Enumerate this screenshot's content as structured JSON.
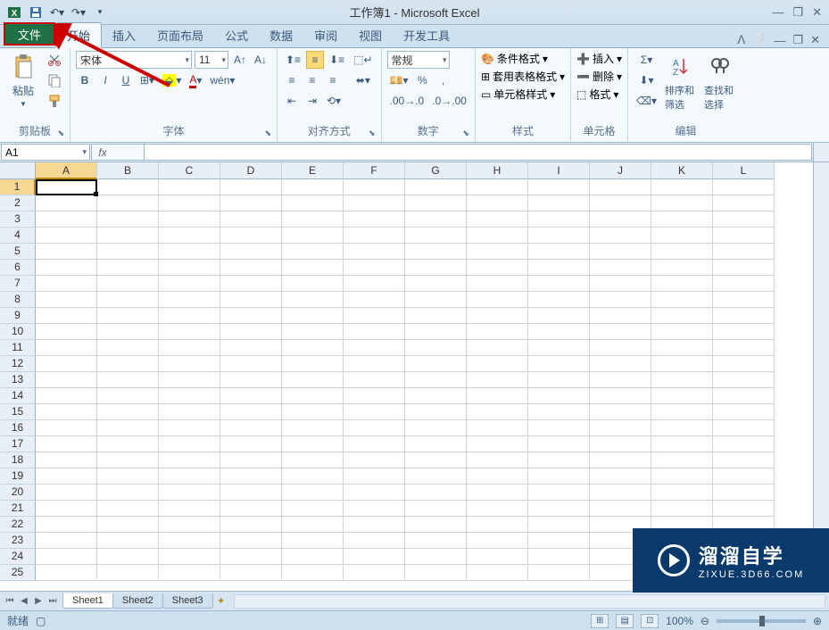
{
  "title": "工作簿1 - Microsoft Excel",
  "tabs": {
    "file": "文件",
    "home": "开始",
    "insert": "插入",
    "layout": "页面布局",
    "formulas": "公式",
    "data": "数据",
    "review": "审阅",
    "view": "视图",
    "dev": "开发工具"
  },
  "ribbon": {
    "clipboard": {
      "paste": "粘贴",
      "label": "剪贴板"
    },
    "font": {
      "name": "宋体",
      "size": "11",
      "label": "字体",
      "bold": "B",
      "italic": "I",
      "underline": "U"
    },
    "alignment": {
      "label": "对齐方式"
    },
    "number": {
      "format": "常规",
      "label": "数字"
    },
    "styles": {
      "cond": "条件格式",
      "table": "套用表格格式",
      "cell": "单元格样式",
      "label": "样式"
    },
    "cells": {
      "insert": "插入",
      "delete": "删除",
      "format": "格式",
      "label": "单元格"
    },
    "editing": {
      "sort": "排序和筛选",
      "find": "查找和选择",
      "label": "编辑"
    }
  },
  "namebox": "A1",
  "fx": "fx",
  "columns": [
    "A",
    "B",
    "C",
    "D",
    "E",
    "F",
    "G",
    "H",
    "I",
    "J",
    "K",
    "L"
  ],
  "rows": [
    "1",
    "2",
    "3",
    "4",
    "5",
    "6",
    "7",
    "8",
    "9",
    "10",
    "11",
    "12",
    "13",
    "14",
    "15",
    "16",
    "17",
    "18",
    "19",
    "20",
    "21",
    "22",
    "23",
    "24",
    "25"
  ],
  "sheets": {
    "s1": "Sheet1",
    "s2": "Sheet2",
    "s3": "Sheet3"
  },
  "status": {
    "ready": "就绪",
    "zoom": "100%"
  },
  "watermark": {
    "main": "溜溜自学",
    "sub": "ZIXUE.3D66.COM"
  }
}
